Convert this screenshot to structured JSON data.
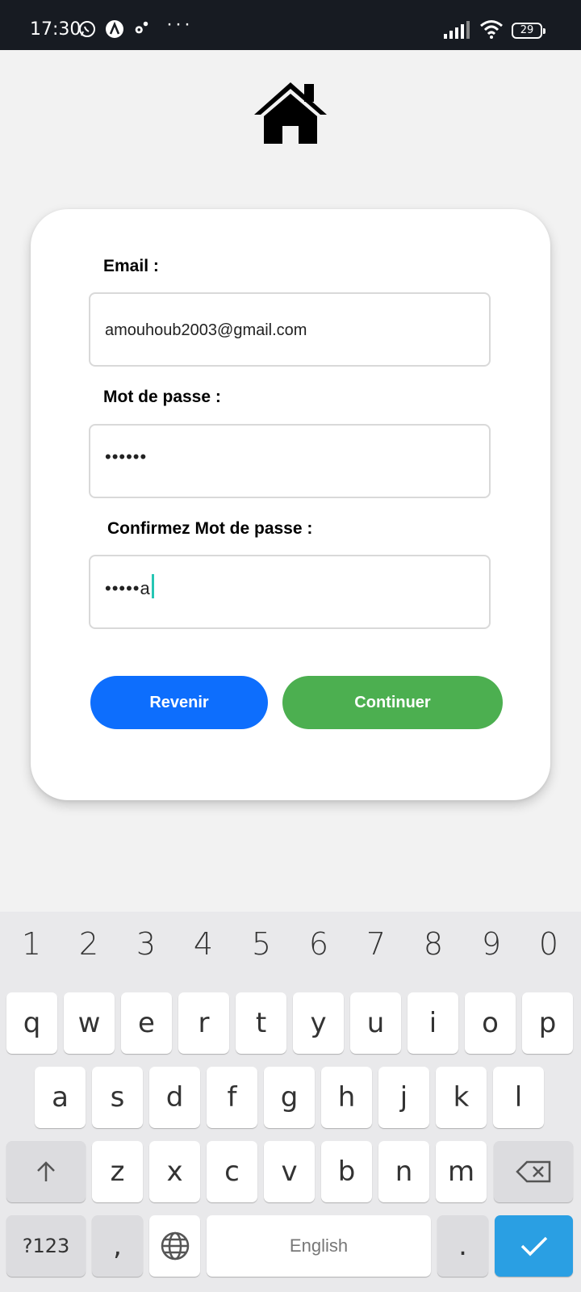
{
  "status_bar": {
    "time": "17:30",
    "battery": "29",
    "icons": [
      "whatsapp-icon",
      "app-a-icon",
      "settings-icon",
      "more-dots-icon",
      "signal-icon",
      "wifi-icon",
      "battery-icon"
    ]
  },
  "header": {
    "logo_icon": "home-icon"
  },
  "form": {
    "email_label": "Email :",
    "email_value": "amouhoub2003@gmail.com",
    "password_label": "Mot de passe :",
    "password_value": "••••••",
    "confirm_label": "Confirmez Mot de passe :",
    "confirm_value": "•••••a",
    "back_button": "Revenir",
    "continue_button": "Continuer",
    "colors": {
      "back": "#0d6efd",
      "continue": "#4caf50"
    }
  },
  "keyboard": {
    "numbers": [
      "1",
      "2",
      "3",
      "4",
      "5",
      "6",
      "7",
      "8",
      "9",
      "0"
    ],
    "row1": [
      "q",
      "w",
      "e",
      "r",
      "t",
      "y",
      "u",
      "i",
      "o",
      "p"
    ],
    "row2": [
      "a",
      "s",
      "d",
      "f",
      "g",
      "h",
      "j",
      "k",
      "l"
    ],
    "row3": [
      "z",
      "x",
      "c",
      "v",
      "b",
      "n",
      "m"
    ],
    "symbols_key": "?123",
    "comma_key": ",",
    "space_label": "English",
    "period_key": ".",
    "icons": [
      "shift-icon",
      "backspace-icon",
      "globe-icon",
      "check-icon"
    ]
  }
}
